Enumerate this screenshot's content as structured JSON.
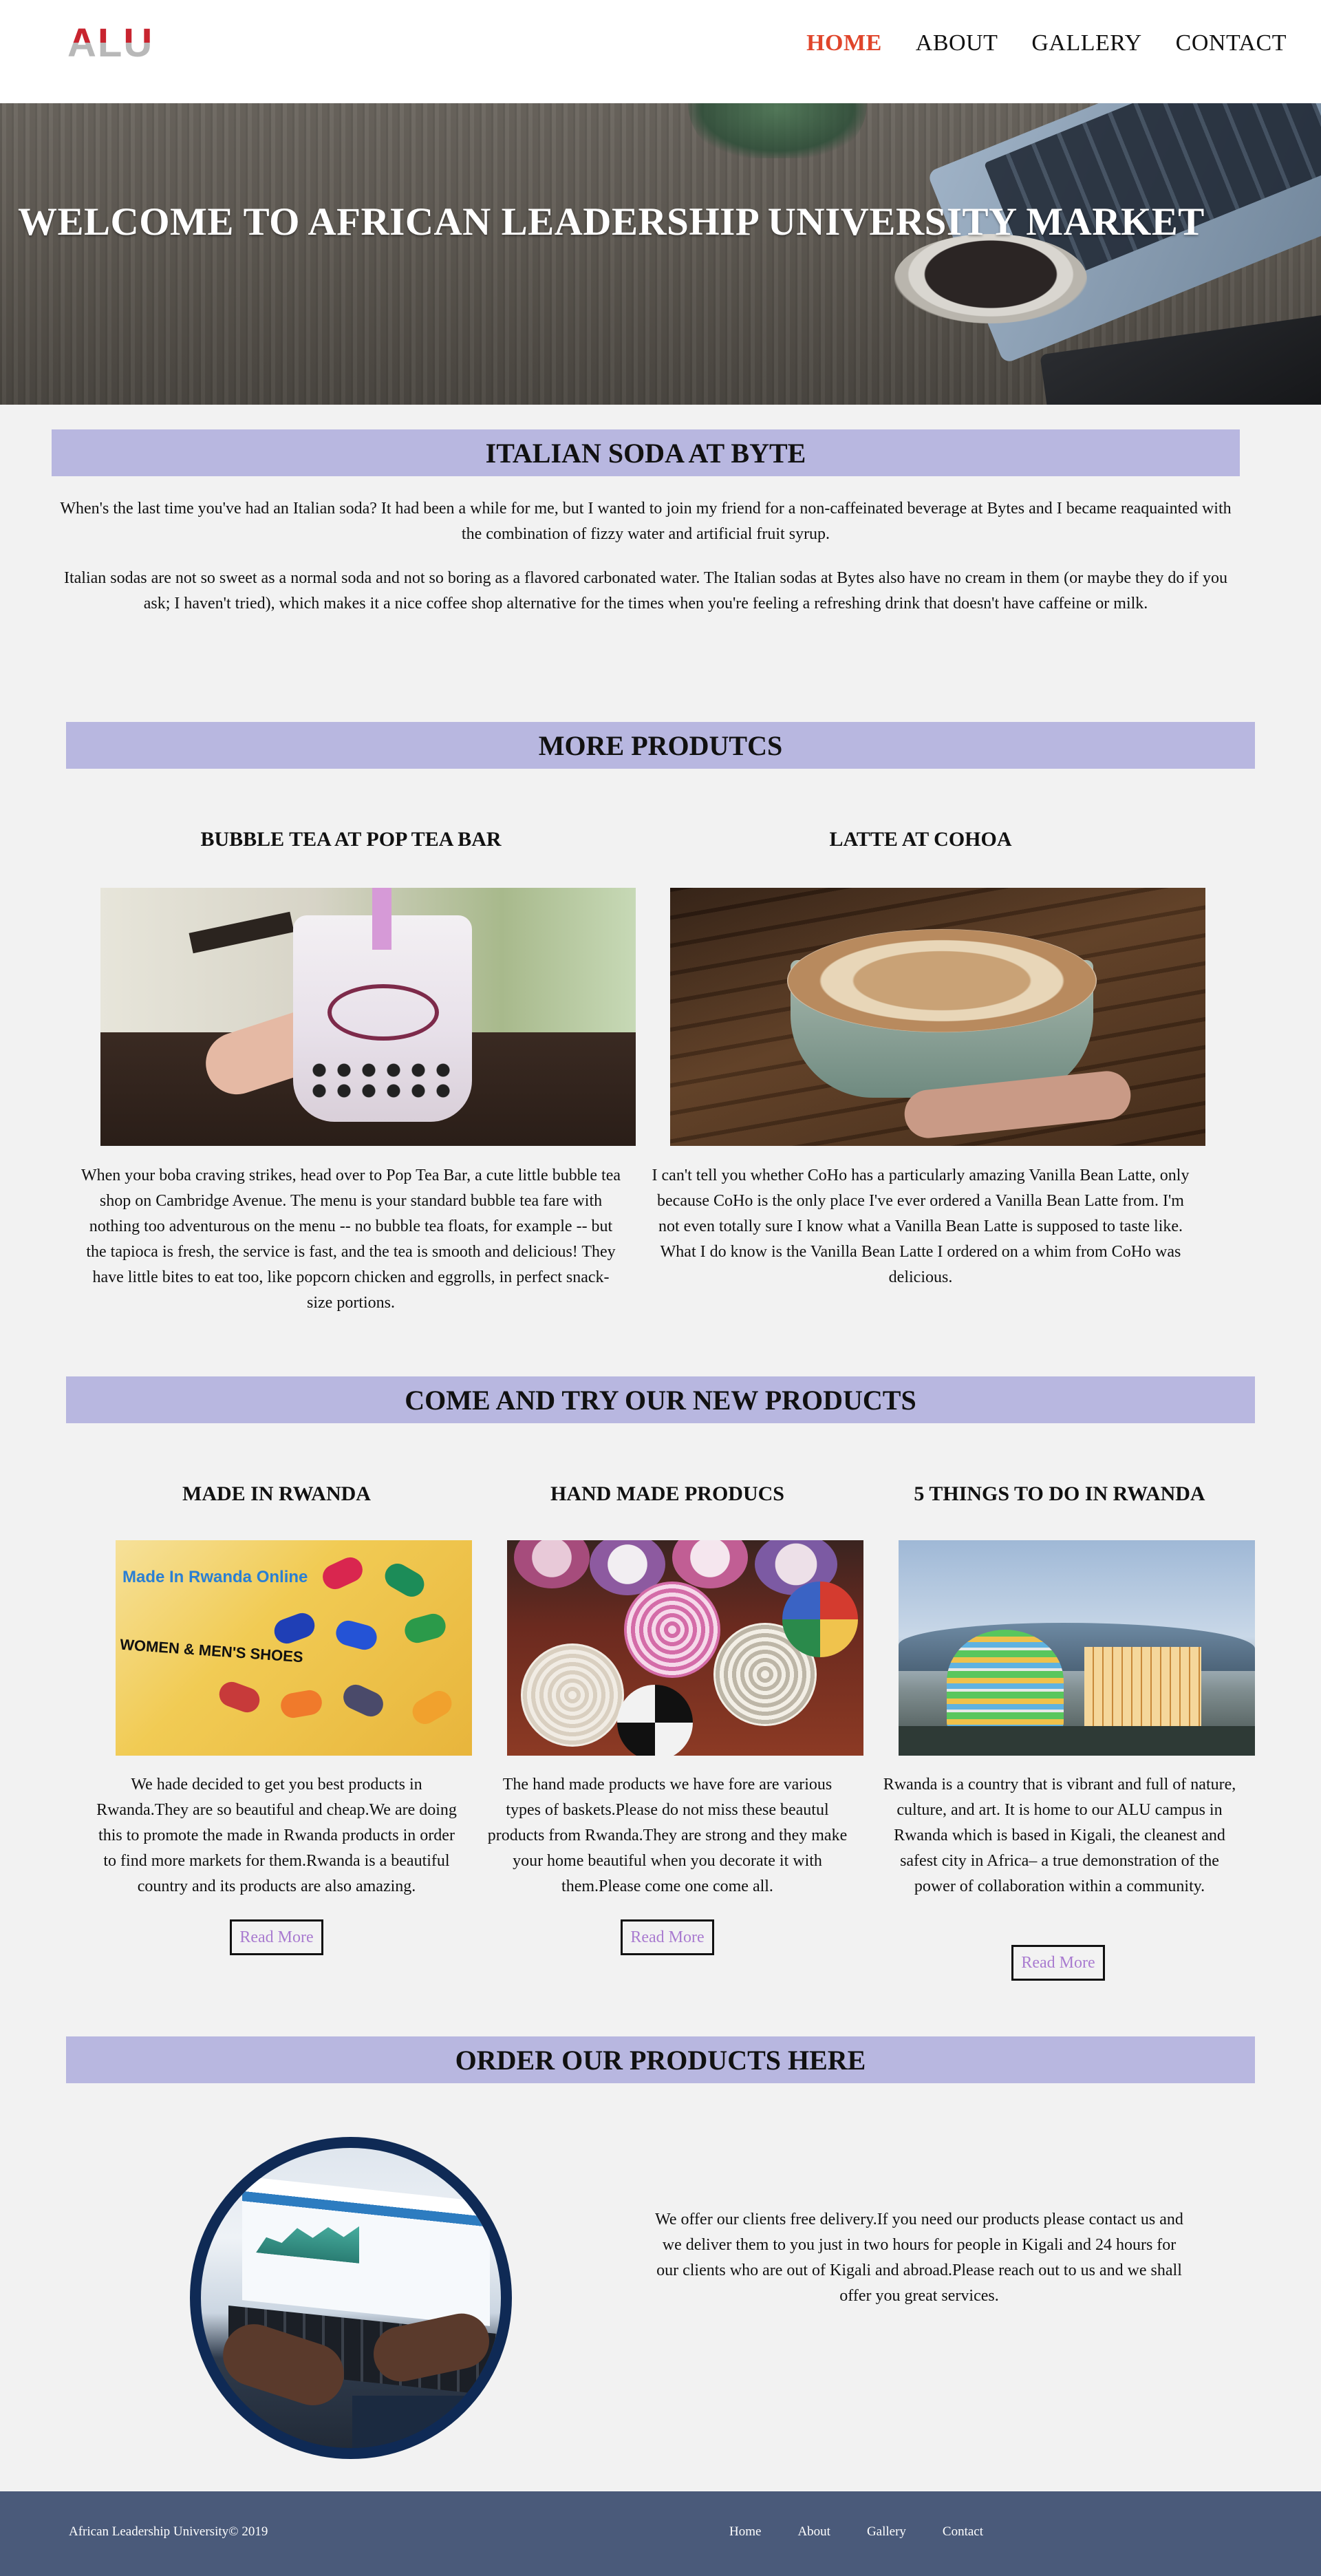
{
  "header": {
    "logo_text": "ALU",
    "nav": [
      {
        "label": "HOME",
        "active": true
      },
      {
        "label": "ABOUT",
        "active": false
      },
      {
        "label": "GALLERY",
        "active": false
      },
      {
        "label": "CONTACT",
        "active": false
      }
    ]
  },
  "hero": {
    "title": "WELCOME TO AFRICAN LEADERSHIP UNIVERSITY MARKET"
  },
  "italian": {
    "title": "ITALIAN SODA AT BYTE",
    "p1": "When's the last time you've had an Italian soda? It had been a while for me, but I wanted to join my friend for a non-caffeinated beverage at Bytes and I became reaquainted with the combination of fizzy water and artificial fruit syrup.",
    "p2": "Italian sodas are not so sweet as a normal soda and not so boring as a flavored carbonated water. The Italian sodas at Bytes also have no cream in them (or maybe they do if you ask; I haven't tried), which makes it a nice coffee shop alternative for the times when you're feeling a refreshing drink that doesn't have caffeine or milk."
  },
  "more": {
    "title": "MORE PRODUTCS",
    "items": [
      {
        "title": "BUBBLE TEA AT POP TEA BAR",
        "text": "When your boba craving strikes, head over to Pop Tea Bar, a cute little bubble tea shop on Cambridge Avenue. The menu is your standard bubble tea fare with nothing too adventurous on the menu -- no bubble tea floats, for example -- but the tapioca is fresh, the service is fast, and the tea is smooth and delicious! They have little bites to eat too, like popcorn chicken and eggrolls, in perfect snack-size portions."
      },
      {
        "title": "LATTE AT COHOA",
        "text": "I can't tell you whether CoHo has a particularly amazing Vanilla Bean Latte, only because CoHo is the only place I've ever ordered a Vanilla Bean Latte from. I'm not even totally sure I know what a Vanilla Bean Latte is supposed to taste like. What I do know is the Vanilla Bean Latte I ordered on a whim from CoHo was delicious."
      }
    ]
  },
  "newproducts": {
    "title": "COME AND TRY OUR NEW PRODUCTS",
    "items": [
      {
        "title": "MADE IN RWANDA",
        "text": "We hade decided to get you best products in Rwanda.They are so beautiful and cheap.We are doing this to promote the made in Rwanda products in order to find more markets for them.Rwanda is a beautiful country and its products are also amazing.",
        "button": "Read More",
        "image_text_1": "Made In Rwanda Online",
        "image_text_2": "WOMEN & MEN'S SHOES"
      },
      {
        "title": "HAND MADE PRODUCS",
        "text": "The hand made products we have fore are various types of baskets.Please do not miss these beautul products from Rwanda.They are strong and they make your home beautiful when you decorate it with them.Please come one come all.",
        "button": "Read More"
      },
      {
        "title": "5 THINGS TO DO IN RWANDA",
        "text": "Rwanda is a country that is vibrant and full of nature, culture, and art. It is home to our ALU campus in Rwanda which is based in Kigali, the cleanest and safest city in Africa– a true demonstration of the power of collaboration within a community.",
        "button": "Read More"
      }
    ]
  },
  "order": {
    "title": "ORDER OUR PRODUCTS HERE",
    "text": "We offer our clients free delivery.If you need our products please contact us and we deliver them to you just in two hours for people in Kigali and 24 hours for our clients who are out of Kigali and abroad.Please reach out to us and we shall offer you great services."
  },
  "footer": {
    "copyright": "African Leadership University© 2019",
    "links": [
      "Home",
      "About",
      "Gallery",
      "Contact"
    ]
  },
  "colors": {
    "accent": "#e0452b",
    "section_bar": "#b8b7e0",
    "footer_bg": "#4a5a7a",
    "read_more": "#a97bd0"
  }
}
